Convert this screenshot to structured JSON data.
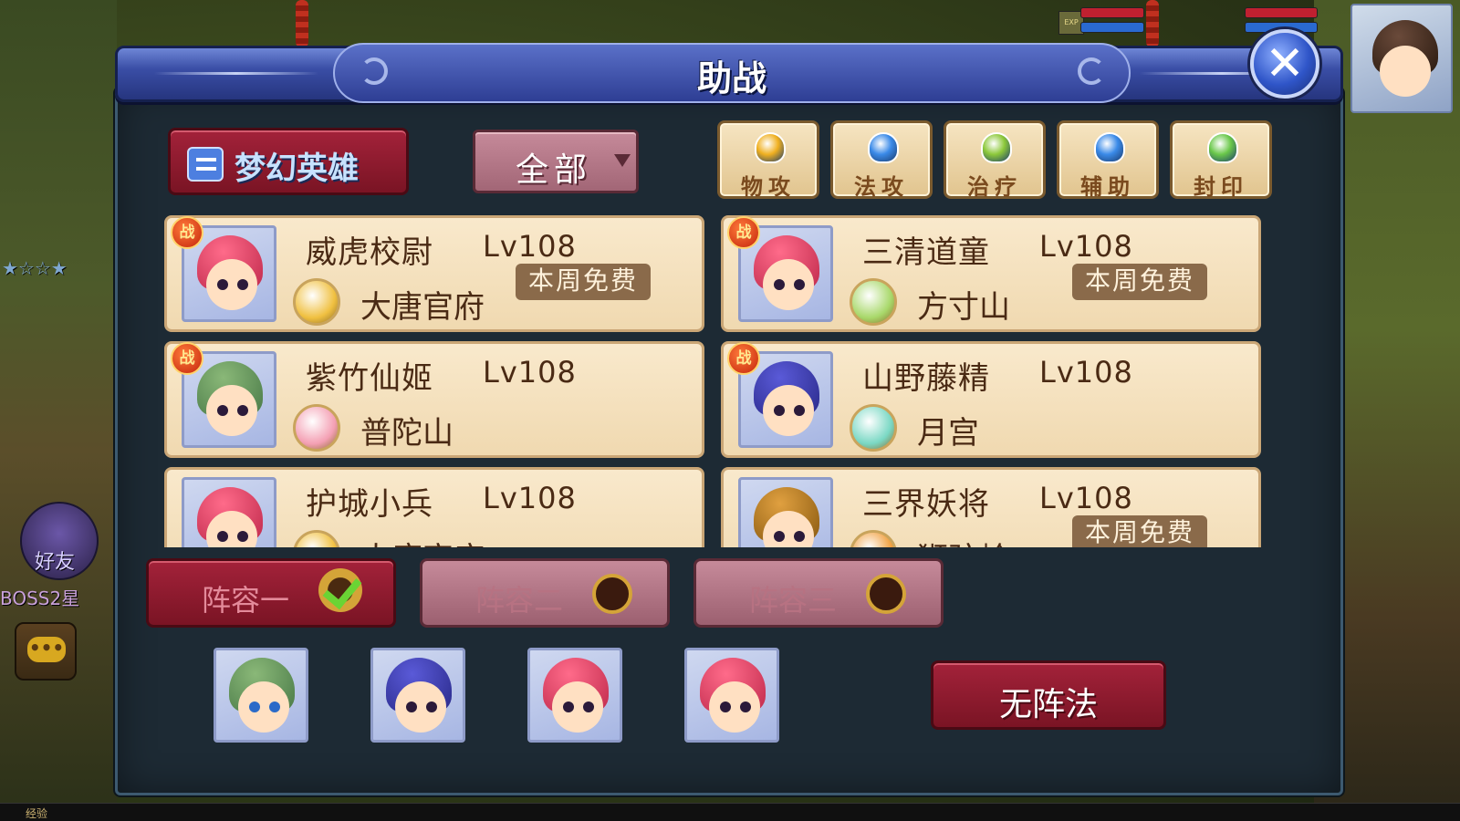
{
  "dialog": {
    "title": "助战",
    "close_label": "✕"
  },
  "hero_group": {
    "label": "梦幻英雄"
  },
  "filter": {
    "selected": "全部"
  },
  "categories": [
    {
      "label": "物攻",
      "icon": "sword-icon",
      "color": "#f0b020"
    },
    {
      "label": "法攻",
      "icon": "magic-orb-icon",
      "color": "#3a8ae8"
    },
    {
      "label": "治疗",
      "icon": "leaf-icon",
      "color": "#8cc83a"
    },
    {
      "label": "辅助",
      "icon": "support-icon",
      "color": "#3a8ae8"
    },
    {
      "label": "封印",
      "icon": "seal-icon",
      "color": "#6ac84a"
    }
  ],
  "heroes": [
    {
      "name": "威虎校尉",
      "level": "Lv108",
      "sect": "大唐官府",
      "free": "本周免费",
      "battle": "战",
      "sect_icon": "sword-coin-icon",
      "sect_color": "#f0c040"
    },
    {
      "name": "三清道童",
      "level": "Lv108",
      "sect": "方寸山",
      "free": "本周免费",
      "battle": "战",
      "sect_icon": "mountain-icon",
      "sect_color": "#a8d86a"
    },
    {
      "name": "紫竹仙姬",
      "level": "Lv108",
      "sect": "普陀山",
      "free": "",
      "battle": "战",
      "sect_icon": "lotus-icon",
      "sect_color": "#f4a0b4"
    },
    {
      "name": "山野藤精",
      "level": "Lv108",
      "sect": "月宫",
      "free": "",
      "battle": "战",
      "sect_icon": "moon-icon",
      "sect_color": "#7ad8c4"
    },
    {
      "name": "护城小兵",
      "level": "Lv108",
      "sect": "大唐官府",
      "free": "",
      "battle": "",
      "sect_icon": "sword-coin-icon",
      "sect_color": "#f0c040"
    },
    {
      "name": "三界妖将",
      "level": "Lv108",
      "sect": "狮驼岭",
      "free": "本周免费",
      "battle": "",
      "sect_icon": "lion-icon",
      "sect_color": "#f0a040"
    }
  ],
  "lineups": [
    {
      "label": "阵容一",
      "active": true
    },
    {
      "label": "阵容二",
      "active": false
    },
    {
      "label": "阵容三",
      "active": false
    }
  ],
  "formation": {
    "label": "无阵法"
  },
  "side": {
    "friend_label": "好友",
    "boss_text": "BOSS2星",
    "stars": "★☆☆★",
    "exp_label": "经验",
    "exp_badge": "EXP"
  }
}
